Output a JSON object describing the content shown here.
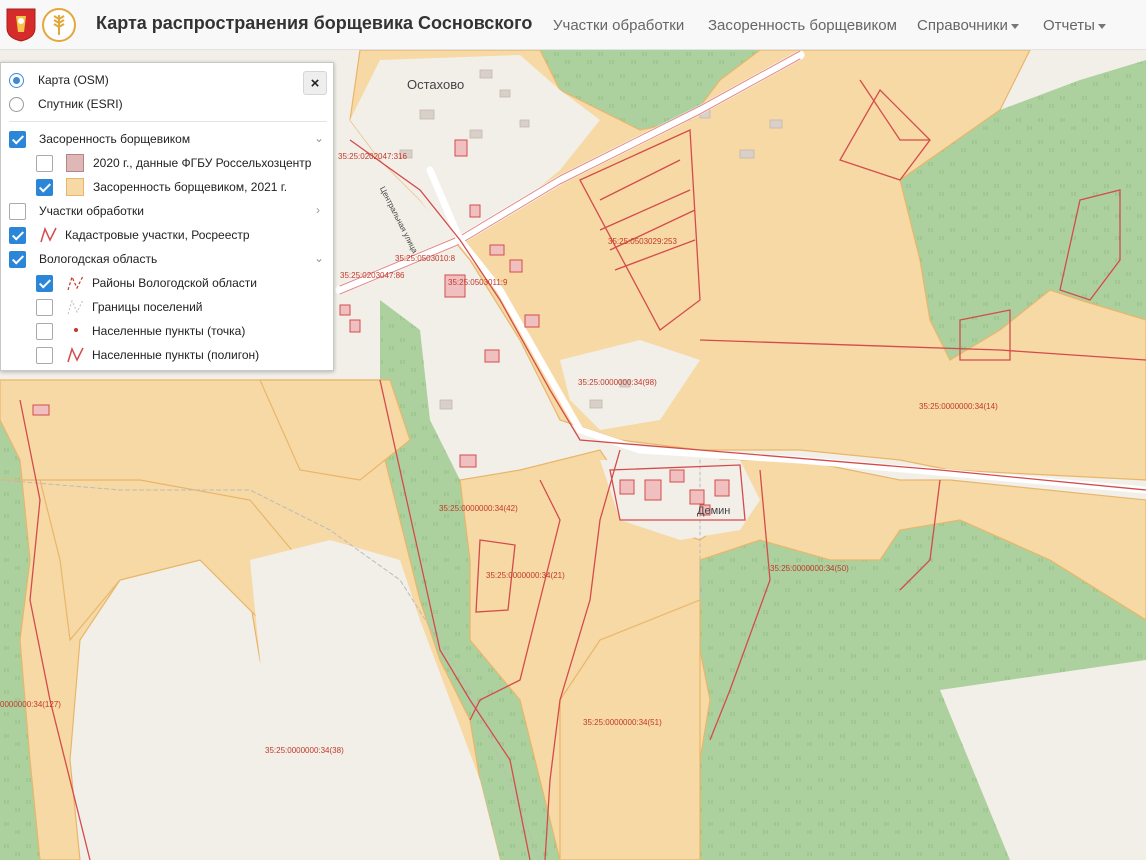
{
  "navbar": {
    "title": "Карта распространения борщевика Сосновского",
    "items": [
      "Участки обработки",
      "Засоренность борщевиком",
      "Справочники",
      "Отчеты"
    ]
  },
  "panel": {
    "basemaps": [
      "Карта (OSM)",
      "Спутник (ESRI)"
    ],
    "close": "×",
    "groups": {
      "weed": "Засоренность борщевиком",
      "weed_2020": "2020 г., данные ФГБУ Россельхозцентр",
      "weed_2021": "Засоренность борщевиком, 2021 г.",
      "treatment": "Участки обработки",
      "cadastral": "Кадастровые участки, Росреестр",
      "region": "Вологодская область",
      "districts": "Районы Вологодской области",
      "settlement_borders": "Границы поселений",
      "localities_point": "Населенные пункты (точка)",
      "localities_polygon": "Населенные пункты (полигон)"
    }
  },
  "map": {
    "places": [
      "Остахово",
      "Демин",
      "Центральная улица"
    ],
    "parcel_labels": [
      "35:25:0202047:316",
      "35:25:0503010:8",
      "35:25:0503029:253",
      "35:25:0203047:86",
      "35:25:0503011:9",
      "35:25:0000000:34(98)",
      "35:25:0000000:34(14)",
      "35:25:0000000:34(42)",
      "35:25:0000000:34(21)",
      "35:25:0000000:34(50)",
      "35:25:0000000:34(51)",
      "35:25:0000000:34(38)",
      "0000000:34(127)"
    ]
  },
  "colors": {
    "field": "#f7d9a5",
    "field_border": "#e8b66a",
    "forest": "#add19e",
    "cadastral": "#d44b4b",
    "checkbox": "#2b86d8"
  }
}
